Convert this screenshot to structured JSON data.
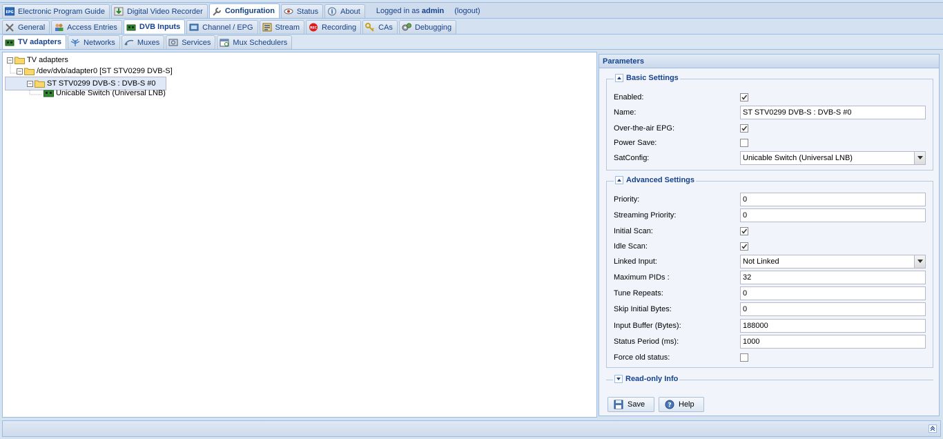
{
  "top_tabs": [
    {
      "label": "Electronic Program Guide",
      "icon": "epg-icon"
    },
    {
      "label": "Digital Video Recorder",
      "icon": "download-icon"
    },
    {
      "label": "Configuration",
      "icon": "wrench-icon"
    },
    {
      "label": "Status",
      "icon": "eye-icon"
    },
    {
      "label": "About",
      "icon": "info-icon"
    }
  ],
  "login": {
    "prefix": "Logged in as",
    "user": "admin",
    "logout": "(logout)"
  },
  "config_tabs": [
    {
      "label": "General",
      "icon": "tools-icon"
    },
    {
      "label": "Access Entries",
      "icon": "users-icon"
    },
    {
      "label": "DVB Inputs",
      "icon": "tv-card-icon"
    },
    {
      "label": "Channel / EPG",
      "icon": "tv-icon"
    },
    {
      "label": "Stream",
      "icon": "stream-icon"
    },
    {
      "label": "Recording",
      "icon": "record-icon"
    },
    {
      "label": "CAs",
      "icon": "key-icon"
    },
    {
      "label": "Debugging",
      "icon": "gears-icon"
    }
  ],
  "dvb_tabs": [
    {
      "label": "TV adapters",
      "icon": "tv-card-icon"
    },
    {
      "label": "Networks",
      "icon": "antenna-icon"
    },
    {
      "label": "Muxes",
      "icon": "mux-icon"
    },
    {
      "label": "Services",
      "icon": "services-icon"
    },
    {
      "label": "Mux Schedulers",
      "icon": "calendar-icon"
    }
  ],
  "tree": {
    "root": "TV adapters",
    "adapter": "/dev/dvb/adapter0 [ST STV0299 DVB-S]",
    "frontend": "ST STV0299 DVB-S : DVB-S #0",
    "satconf": "Unicable Switch (Universal LNB)"
  },
  "params": {
    "title": "Parameters",
    "basic": {
      "legend": "Basic Settings",
      "enabled_label": "Enabled:",
      "enabled": true,
      "name_label": "Name:",
      "name_value": "ST STV0299 DVB-S : DVB-S #0",
      "epg_label": "Over-the-air EPG:",
      "epg": true,
      "power_label": "Power Save:",
      "power": false,
      "satconfig_label": "SatConfig:",
      "satconfig_value": "Unicable Switch (Universal LNB)"
    },
    "advanced": {
      "legend": "Advanced Settings",
      "priority_label": "Priority:",
      "priority_value": "0",
      "streaming_label": "Streaming Priority:",
      "streaming_value": "0",
      "initial_label": "Initial Scan:",
      "initial": true,
      "idle_label": "Idle Scan:",
      "idle": true,
      "linked_label": "Linked Input:",
      "linked_value": "Not Linked",
      "maxpids_label": "Maximum PIDs :",
      "maxpids_value": "32",
      "tune_label": "Tune Repeats:",
      "tune_value": "0",
      "skip_label": "Skip Initial Bytes:",
      "skip_value": "0",
      "buffer_label": "Input Buffer (Bytes):",
      "buffer_value": "188000",
      "status_label": "Status Period (ms):",
      "status_value": "1000",
      "force_label": "Force old status:",
      "force": false
    },
    "readonly": {
      "legend": "Read-only Info"
    },
    "save_label": "Save",
    "help_label": "Help"
  }
}
